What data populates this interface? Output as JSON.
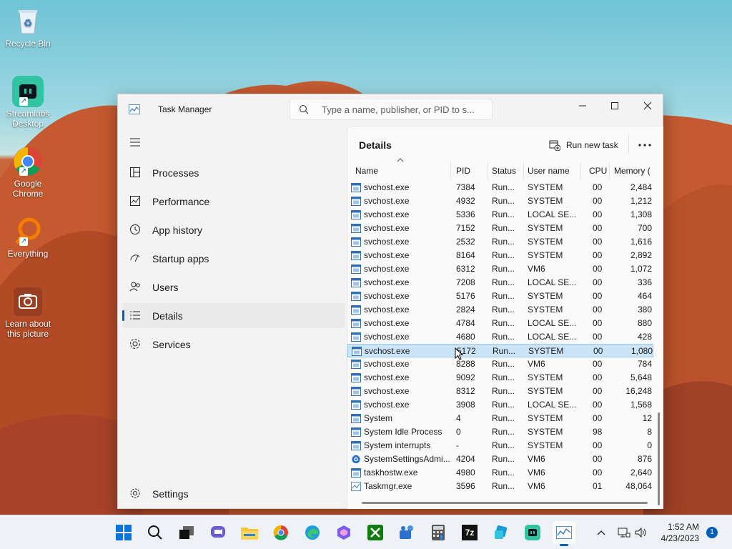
{
  "desktop": {
    "icons": [
      {
        "label": "Recycle Bin",
        "icon": "recycle-bin-icon"
      },
      {
        "label": "Streamlabs Desktop",
        "icon": "streamlabs-icon"
      },
      {
        "label": "Google Chrome",
        "icon": "chrome-icon"
      },
      {
        "label": "Everything",
        "icon": "everything-search-icon"
      },
      {
        "label": "Learn about this picture",
        "icon": "camera-icon"
      }
    ]
  },
  "window": {
    "title": "Task Manager",
    "search_placeholder": "Type a name, publisher, or PID to s...",
    "controls": {
      "minimize": "minimize-icon",
      "maximize": "maximize-icon",
      "close": "close-icon"
    }
  },
  "sidebar": {
    "items": [
      {
        "label": "Processes",
        "icon": "processes-icon"
      },
      {
        "label": "Performance",
        "icon": "performance-icon"
      },
      {
        "label": "App history",
        "icon": "app-history-icon"
      },
      {
        "label": "Startup apps",
        "icon": "startup-icon"
      },
      {
        "label": "Users",
        "icon": "users-icon"
      },
      {
        "label": "Details",
        "icon": "details-icon",
        "active": true
      },
      {
        "label": "Services",
        "icon": "services-icon"
      }
    ],
    "settings_label": "Settings"
  },
  "details": {
    "title": "Details",
    "run_new_task_label": "Run new task",
    "columns": [
      "Name",
      "PID",
      "Status",
      "User name",
      "CPU",
      "Memory ("
    ],
    "rows": [
      {
        "name": "svchost.exe",
        "pid": "7384",
        "status": "Run...",
        "user": "SYSTEM",
        "cpu": "00",
        "mem": "2,484"
      },
      {
        "name": "svchost.exe",
        "pid": "4932",
        "status": "Run...",
        "user": "SYSTEM",
        "cpu": "00",
        "mem": "1,212"
      },
      {
        "name": "svchost.exe",
        "pid": "5336",
        "status": "Run...",
        "user": "LOCAL SE...",
        "cpu": "00",
        "mem": "1,308"
      },
      {
        "name": "svchost.exe",
        "pid": "7152",
        "status": "Run...",
        "user": "SYSTEM",
        "cpu": "00",
        "mem": "700"
      },
      {
        "name": "svchost.exe",
        "pid": "2532",
        "status": "Run...",
        "user": "SYSTEM",
        "cpu": "00",
        "mem": "1,616"
      },
      {
        "name": "svchost.exe",
        "pid": "8164",
        "status": "Run...",
        "user": "SYSTEM",
        "cpu": "00",
        "mem": "2,892"
      },
      {
        "name": "svchost.exe",
        "pid": "6312",
        "status": "Run...",
        "user": "VM6",
        "cpu": "00",
        "mem": "1,072"
      },
      {
        "name": "svchost.exe",
        "pid": "7208",
        "status": "Run...",
        "user": "LOCAL SE...",
        "cpu": "00",
        "mem": "336"
      },
      {
        "name": "svchost.exe",
        "pid": "5176",
        "status": "Run...",
        "user": "SYSTEM",
        "cpu": "00",
        "mem": "464"
      },
      {
        "name": "svchost.exe",
        "pid": "2824",
        "status": "Run...",
        "user": "SYSTEM",
        "cpu": "00",
        "mem": "380"
      },
      {
        "name": "svchost.exe",
        "pid": "4784",
        "status": "Run...",
        "user": "LOCAL SE...",
        "cpu": "00",
        "mem": "880"
      },
      {
        "name": "svchost.exe",
        "pid": "4680",
        "status": "Run...",
        "user": "LOCAL SE...",
        "cpu": "00",
        "mem": "428"
      },
      {
        "name": "svchost.exe",
        "pid": "5172",
        "status": "Run...",
        "user": "SYSTEM",
        "cpu": "00",
        "mem": "1,080",
        "selected": true
      },
      {
        "name": "svchost.exe",
        "pid": "8288",
        "status": "Run...",
        "user": "VM6",
        "cpu": "00",
        "mem": "784"
      },
      {
        "name": "svchost.exe",
        "pid": "9092",
        "status": "Run...",
        "user": "SYSTEM",
        "cpu": "00",
        "mem": "5,648"
      },
      {
        "name": "svchost.exe",
        "pid": "8312",
        "status": "Run...",
        "user": "SYSTEM",
        "cpu": "00",
        "mem": "16,248"
      },
      {
        "name": "svchost.exe",
        "pid": "3908",
        "status": "Run...",
        "user": "LOCAL SE...",
        "cpu": "00",
        "mem": "1,568"
      },
      {
        "name": "System",
        "pid": "4",
        "status": "Run...",
        "user": "SYSTEM",
        "cpu": "00",
        "mem": "12"
      },
      {
        "name": "System Idle Process",
        "pid": "0",
        "status": "Run...",
        "user": "SYSTEM",
        "cpu": "98",
        "mem": "8"
      },
      {
        "name": "System interrupts",
        "pid": "-",
        "status": "Run...",
        "user": "SYSTEM",
        "cpu": "00",
        "mem": "0"
      },
      {
        "name": "SystemSettingsAdmi...",
        "pid": "4204",
        "status": "Run...",
        "user": "VM6",
        "cpu": "00",
        "mem": "876",
        "icon": "settings-gear"
      },
      {
        "name": "taskhostw.exe",
        "pid": "4980",
        "status": "Run...",
        "user": "VM6",
        "cpu": "00",
        "mem": "2,640"
      },
      {
        "name": "Taskmgr.exe",
        "pid": "3596",
        "status": "Run...",
        "user": "VM6",
        "cpu": "01",
        "mem": "48,064",
        "icon": "taskmgr"
      }
    ]
  },
  "taskbar": {
    "apps": [
      "windows-start-icon",
      "search-icon",
      "task-view-icon",
      "chat-icon",
      "file-explorer-icon",
      "chrome-icon",
      "edge-icon",
      "copilot-icon",
      "xbox-icon",
      "teams-icon",
      "calculator-icon",
      "7zip-icon",
      "remote-icon",
      "streamlabs-icon",
      "task-manager-icon"
    ],
    "app_7zip_label": "7z",
    "time": "1:52 AM",
    "date": "4/23/2023",
    "notification_count": "1"
  },
  "colors": {
    "accent": "#005fb8",
    "selection": "#cce4f7"
  }
}
